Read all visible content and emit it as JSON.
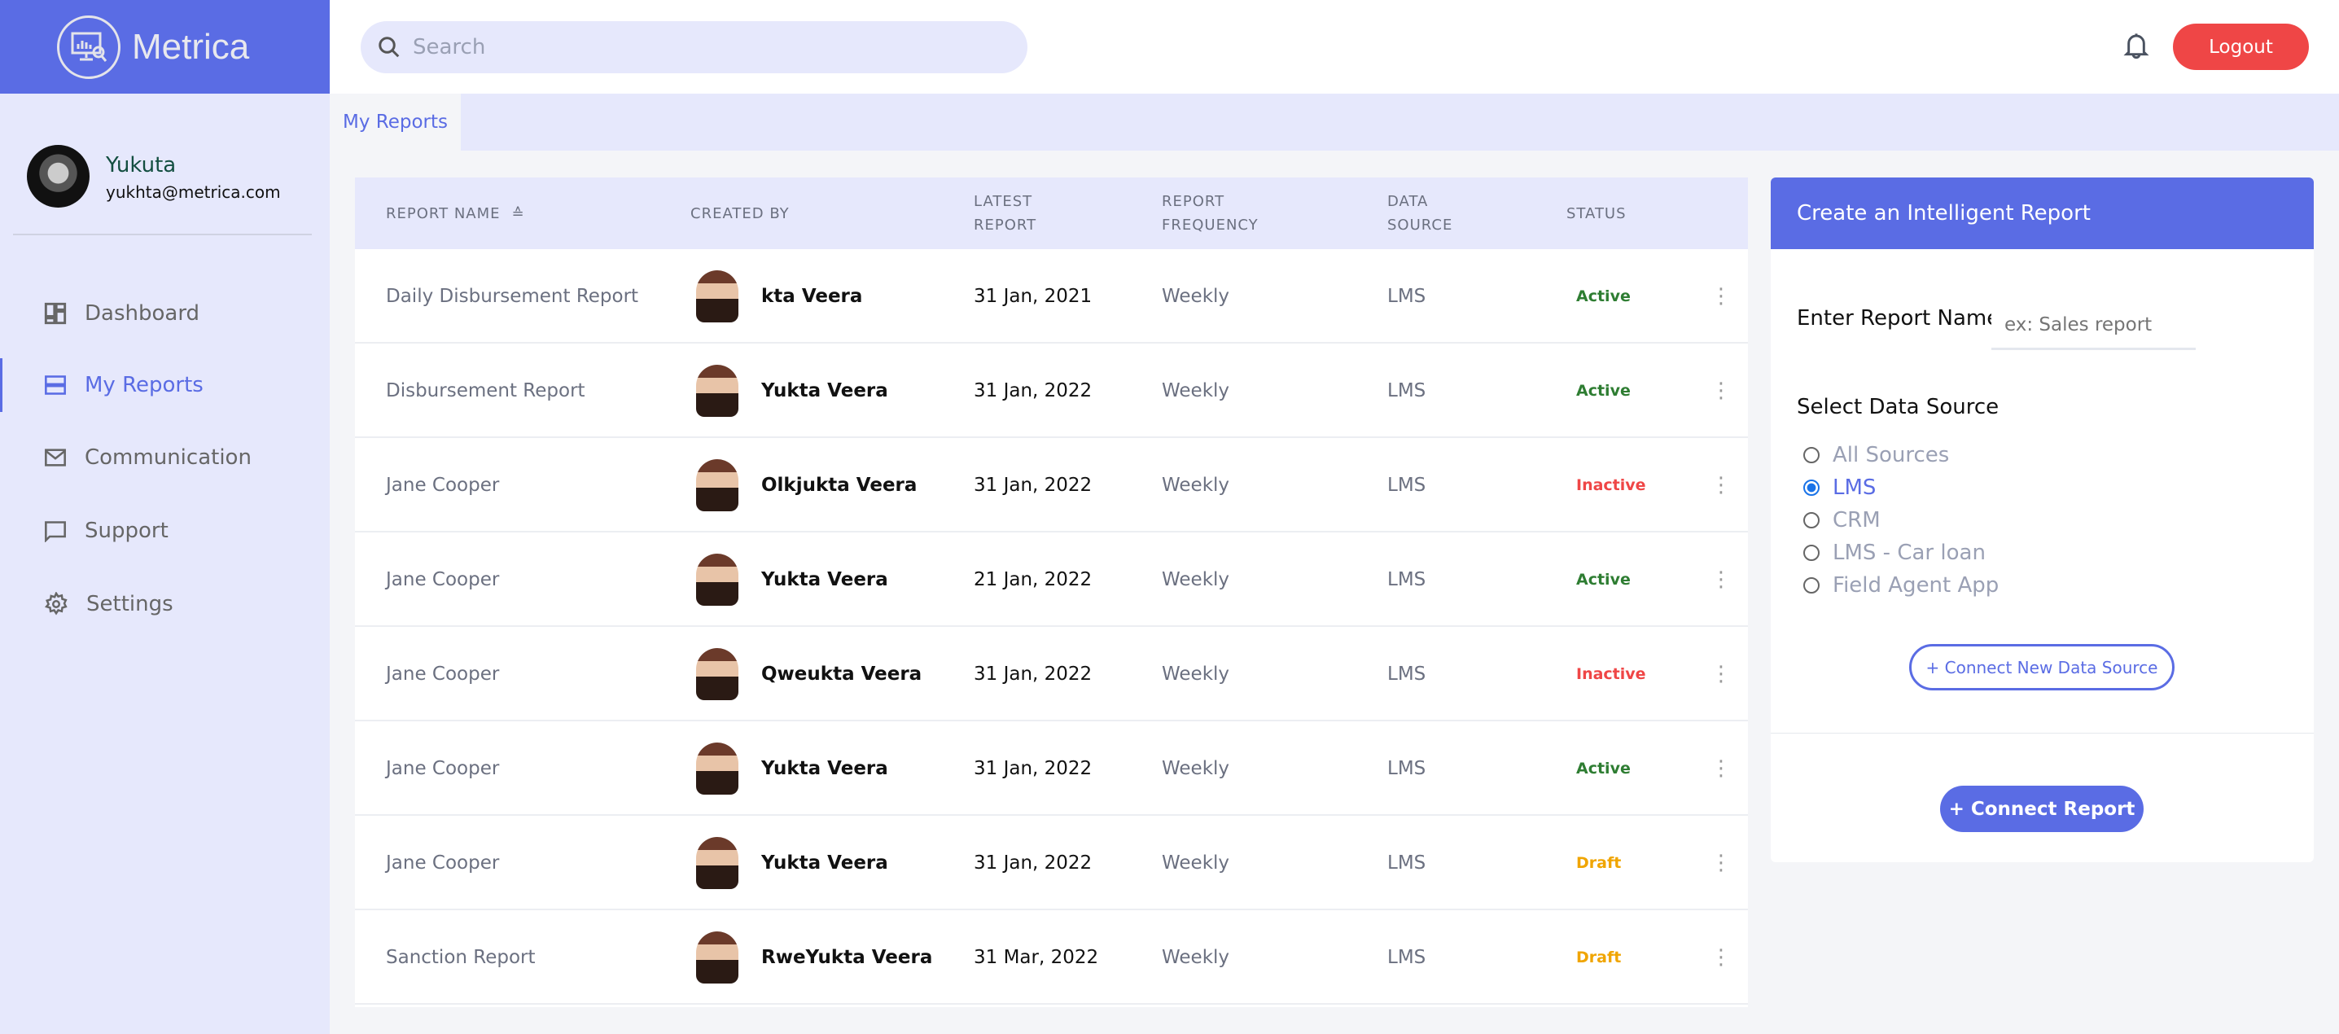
{
  "brand": {
    "name": "Metrica",
    "primary_color": "#5a6ce4"
  },
  "header": {
    "search_placeholder": "Search",
    "logout_label": "Logout",
    "logout_color": "#ef4646"
  },
  "user": {
    "name": "Yukuta",
    "email": "yukhta@metrica.com"
  },
  "sidebar": {
    "items": [
      {
        "label": "Dashboard",
        "icon": "dashboard-icon",
        "active": false
      },
      {
        "label": "My Reports",
        "icon": "reports-icon",
        "active": true
      },
      {
        "label": "Communication",
        "icon": "mail-icon",
        "active": false
      },
      {
        "label": "Support",
        "icon": "chat-icon",
        "active": false
      },
      {
        "label": "Settings",
        "icon": "gear-icon",
        "active": false
      }
    ]
  },
  "tabs": [
    {
      "label": "My Reports",
      "active": true
    }
  ],
  "table": {
    "headers": {
      "name": "REPORT NAME",
      "created": "CREATED BY",
      "latest_1": "LATEST",
      "latest_2": "REPORT",
      "freq_1": "REPORT",
      "freq_2": "FREQUENCY",
      "ds_1": "DATA",
      "ds_2": "SOURCE",
      "status": "STATUS"
    },
    "status_colors": {
      "Active": "#2e7d32",
      "Inactive": "#ef4646",
      "Draft": "#f0a500"
    },
    "rows": [
      {
        "name": "Daily Disbursement Report",
        "created_by": "kta Veera",
        "latest": "31 Jan, 2021",
        "frequency": "Weekly",
        "source": "LMS",
        "status": "Active"
      },
      {
        "name": "Disbursement Report",
        "created_by": "Yukta Veera",
        "latest": "31 Jan, 2022",
        "frequency": "Weekly",
        "source": "LMS",
        "status": "Active"
      },
      {
        "name": "Jane Cooper",
        "created_by": "Olkjukta Veera",
        "latest": "31 Jan, 2022",
        "frequency": "Weekly",
        "source": "LMS",
        "status": "Inactive"
      },
      {
        "name": "Jane Cooper",
        "created_by": "Yukta Veera",
        "latest": "21 Jan, 2022",
        "frequency": "Weekly",
        "source": "LMS",
        "status": "Active"
      },
      {
        "name": "Jane Cooper",
        "created_by": "Qweukta Veera",
        "latest": "31 Jan, 2022",
        "frequency": "Weekly",
        "source": "LMS",
        "status": "Inactive"
      },
      {
        "name": "Jane Cooper",
        "created_by": "Yukta Veera",
        "latest": "31 Jan, 2022",
        "frequency": "Weekly",
        "source": "LMS",
        "status": "Active"
      },
      {
        "name": "Jane Cooper",
        "created_by": "Yukta Veera",
        "latest": "31 Jan, 2022",
        "frequency": "Weekly",
        "source": "LMS",
        "status": "Draft"
      },
      {
        "name": "Sanction Report",
        "created_by": "RweYukta Veera",
        "latest": "31 Mar, 2022",
        "frequency": "Weekly",
        "source": "LMS",
        "status": "Draft"
      }
    ]
  },
  "panel": {
    "title": "Create an Intelligent Report",
    "name_label": "Enter Report Name",
    "name_placeholder": "ex: Sales report",
    "name_value": "",
    "source_label": "Select Data Source",
    "sources": [
      {
        "label": "All Sources",
        "selected": false
      },
      {
        "label": "LMS",
        "selected": true
      },
      {
        "label": "CRM",
        "selected": false
      },
      {
        "label": "LMS - Car loan",
        "selected": false
      },
      {
        "label": "Field Agent App",
        "selected": false
      }
    ],
    "connect_source_label": "+ Connect New Data Source",
    "connect_report_label": "+ Connect Report"
  }
}
